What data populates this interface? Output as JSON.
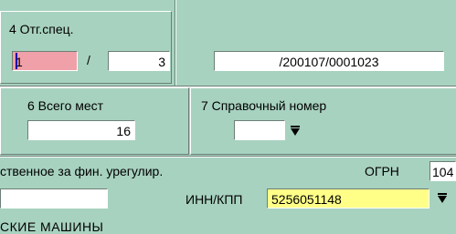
{
  "section4": {
    "title": "4 Отг.спец.",
    "field_a": "1",
    "separator": "/",
    "field_b": "3",
    "doc_number": "/200107/0001023"
  },
  "section6": {
    "title": "6 Всего мест",
    "value": "16"
  },
  "section7": {
    "title": "7 Справочный номер",
    "value": ""
  },
  "bottom": {
    "responsible_label": "ственное за фин. урегулир.",
    "ogrn_label": "ОГРН",
    "ogrn_value": "104",
    "left_field_value": "",
    "inn_label": "ИНН/КПП",
    "inn_value": "5256051148",
    "truncated_text": "СКИЕ МАШИНЫ"
  },
  "colors": {
    "background": "#a7d2bf",
    "active_field": "#f0a0a8",
    "highlight_field": "#ffff88"
  },
  "icons": {
    "dropdown": "dropdown-arrow-icon"
  }
}
